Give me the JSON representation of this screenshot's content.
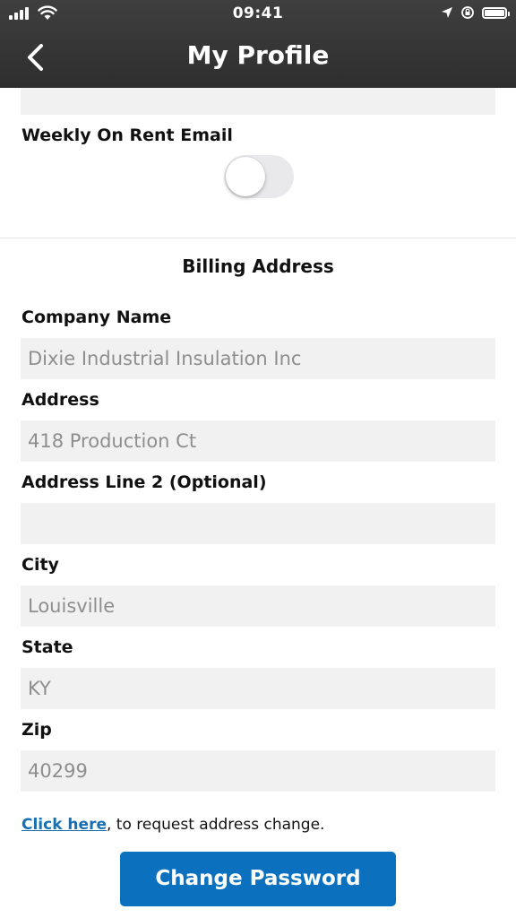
{
  "status_bar": {
    "time": "09:41"
  },
  "header": {
    "title": "My Profile",
    "back_icon": "chevron-left-icon"
  },
  "notifications": {
    "weekly_on_rent_email_label": "Weekly On Rent Email",
    "weekly_on_rent_email_enabled": false
  },
  "billing": {
    "section_title": "Billing Address",
    "fields": [
      {
        "label": "Company Name",
        "value": "Dixie Industrial Insulation Inc"
      },
      {
        "label": "Address",
        "value": "418 Production Ct"
      },
      {
        "label": "Address Line 2 (Optional)",
        "value": ""
      },
      {
        "label": "City",
        "value": "Louisville"
      },
      {
        "label": "State",
        "value": "KY"
      },
      {
        "label": "Zip",
        "value": "40299"
      }
    ]
  },
  "address_change": {
    "link_text": "Click here",
    "rest_text": ", to request address change."
  },
  "actions": {
    "change_password_label": "Change Password"
  },
  "colors": {
    "header_background": "#353535",
    "field_background": "#f1f1f1",
    "primary_button": "#0b71bf",
    "link": "#1a6fb0",
    "toggle_off_track": "#e9e9eb"
  }
}
